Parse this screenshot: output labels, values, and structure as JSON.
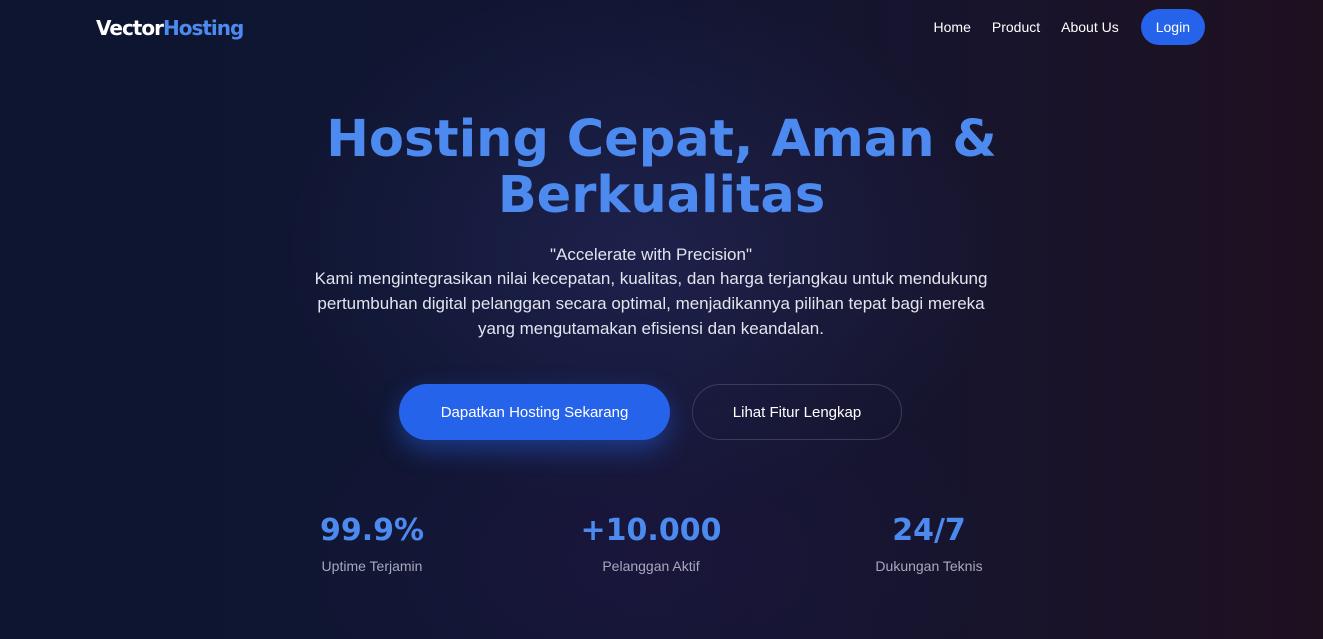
{
  "navbar": {
    "logo": {
      "part1": "Vector",
      "part2": "Hosting"
    },
    "links": [
      "Home",
      "Product",
      "About Us"
    ],
    "login_label": "Login"
  },
  "hero": {
    "title_line1": "Hosting Cepat, Aman &",
    "title_line2": "Berkualitas",
    "tagline": "\"Accelerate with Precision\"",
    "description": "Kami mengintegrasikan nilai kecepatan, kualitas, dan harga terjangkau untuk mendukung pertumbuhan digital pelanggan secara optimal, menjadikannya pilihan tepat bagi mereka yang mengutamakan efisiensi dan keandalan.",
    "primary_button": "Dapatkan Hosting Sekarang",
    "secondary_button": "Lihat Fitur Lengkap"
  },
  "stats": [
    {
      "value": "99.9%",
      "label": "Uptime Terjamin"
    },
    {
      "value": "+10.000",
      "label": "Pelanggan Aktif"
    },
    {
      "value": "24/7",
      "label": "Dukungan Teknis"
    }
  ],
  "colors": {
    "accent": "#2563eb",
    "accent_text": "#4d8af0",
    "background": "#111633"
  }
}
